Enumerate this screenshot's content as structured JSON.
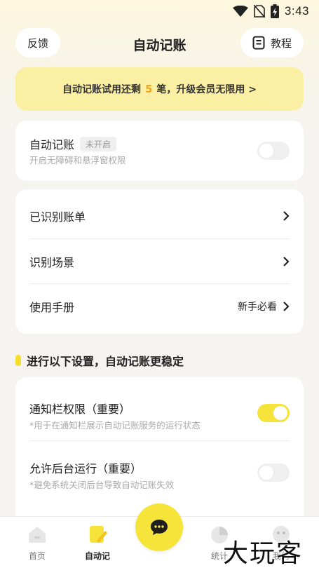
{
  "status_bar": {
    "time": "3:43",
    "icons": [
      "wifi-icon",
      "no-sim-icon",
      "battery-charging-icon"
    ]
  },
  "header": {
    "title": "自动记账",
    "feedback_label": "反馈",
    "tutorial_label": "教程",
    "tutorial_icon": "document-icon"
  },
  "banner": {
    "text_before": "自动记账试用还剩",
    "count": "5",
    "text_after": "笔，升级会员无限用 >"
  },
  "auto_card": {
    "title": "自动记账",
    "badge": "未开启",
    "subtitle": "开启无障碍和悬浮窗权限",
    "toggle_on": false
  },
  "menu": {
    "items": [
      {
        "label": "已识别账单",
        "hint": ""
      },
      {
        "label": "识别场景",
        "hint": ""
      },
      {
        "label": "使用手册",
        "hint": "新手必看"
      }
    ]
  },
  "settings_section": {
    "title": "进行以下设置，自动记账更稳定",
    "accent_color": "#f6df2c",
    "rows": [
      {
        "title": "通知栏权限（重要）",
        "subtitle": "*用于在通知栏展示自动记账服务的运行状态",
        "toggle_on": true
      },
      {
        "title": "允许后台运行（重要）",
        "subtitle": "*避免系统关闭后台导致自动记账失效",
        "toggle_on": false
      }
    ]
  },
  "bottom_nav": {
    "items": [
      {
        "label": "首页",
        "icon": "home-icon",
        "active": false
      },
      {
        "label": "自动记",
        "icon": "auto-bookkeeping-icon",
        "active": true
      },
      {
        "label": "统计",
        "icon": "pie-chart-icon",
        "active": false
      },
      {
        "label": "我的",
        "icon": "profile-icon",
        "active": false
      }
    ],
    "fab_icon": "chat-bubble-icon"
  },
  "watermark": "大玩客",
  "colors": {
    "accent_yellow": "#f6e33a",
    "banner_bg": "#fbefa3",
    "count_orange": "#f4a51c"
  }
}
